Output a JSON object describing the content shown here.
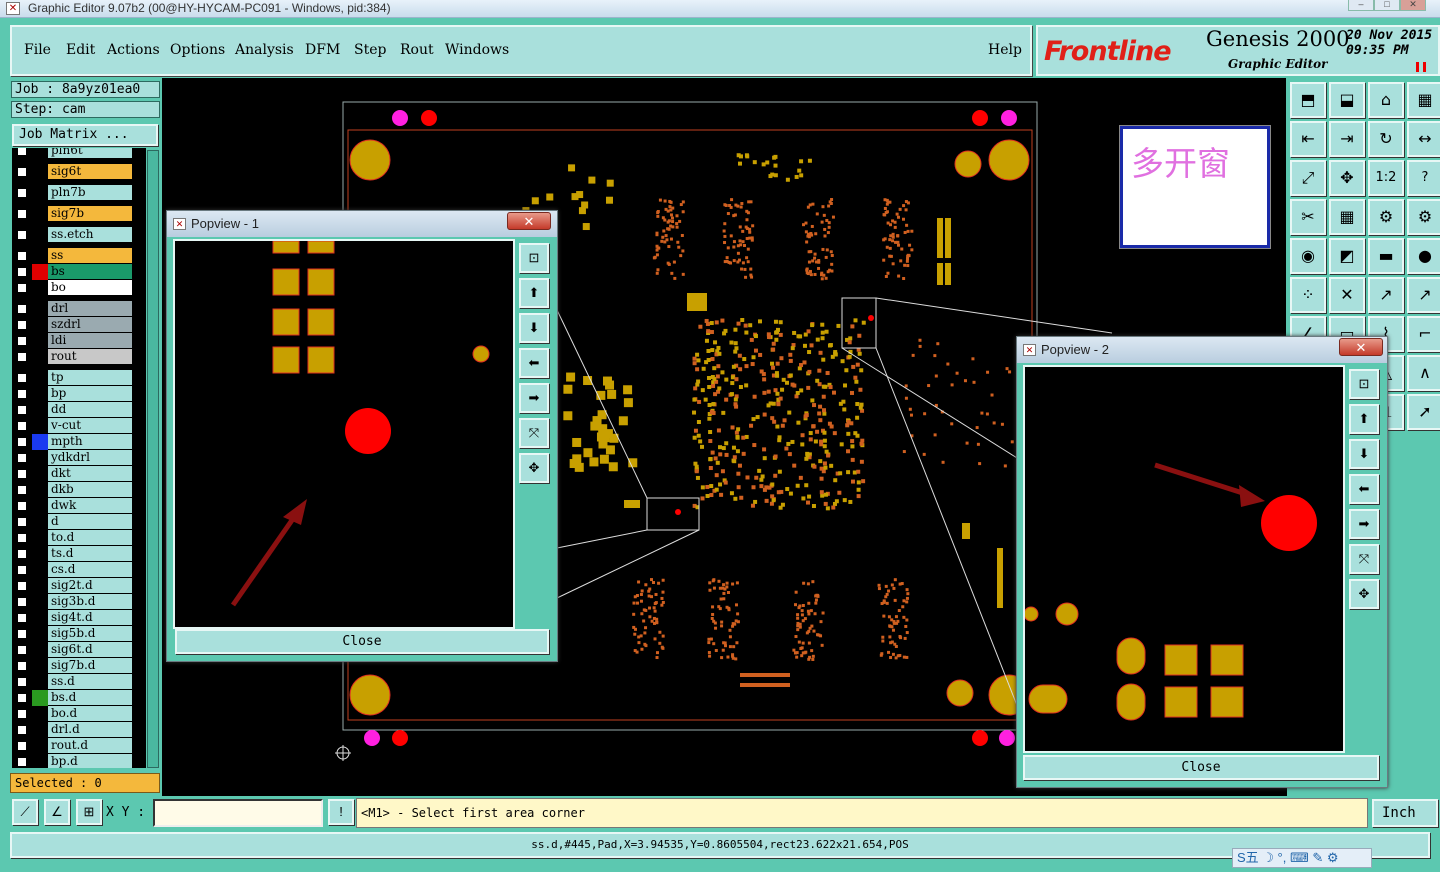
{
  "window": {
    "title": "Graphic Editor 9.07b2 (00@HY-HYCAM-PC091 - Windows, pid:384)"
  },
  "menu": {
    "file": "File",
    "edit": "Edit",
    "actions": "Actions",
    "options": "Options",
    "analysis": "Analysis",
    "dfm": "DFM",
    "step": "Step",
    "rout": "Rout",
    "windows": "Windows",
    "help": "Help"
  },
  "logo": {
    "brand": "Frontline",
    "product": "Genesis 2000",
    "subtitle": "Graphic Editor",
    "date": "20 Nov 2015",
    "time": "09:35 PM"
  },
  "job": {
    "job_label": "Job : 8a9yz01ea0",
    "step_label": "Step: cam",
    "matrix_button": "Job Matrix ..."
  },
  "layers": [
    {
      "name": "pln6t",
      "color": "#a9e0dc",
      "swatch": ""
    },
    {
      "name": "sig6t",
      "color": "#f4b83c",
      "swatch": ""
    },
    {
      "name": "pln7b",
      "color": "#a9e0dc",
      "swatch": ""
    },
    {
      "name": "sig7b",
      "color": "#f4b83c",
      "swatch": ""
    },
    {
      "name": "ss.etch",
      "color": "#a9e0dc",
      "swatch": ""
    },
    {
      "name": "ss",
      "color": "#f4b83c",
      "swatch": ""
    },
    {
      "name": "bs",
      "color": "#1a9a6a",
      "swatch": "#e00000"
    },
    {
      "name": "bo",
      "color": "#ffffff",
      "swatch": ""
    },
    {
      "name": "drl",
      "color": "#9aaab0",
      "swatch": ""
    },
    {
      "name": "szdrl",
      "color": "#9aaab0",
      "swatch": ""
    },
    {
      "name": "ldi",
      "color": "#9aaab0",
      "swatch": ""
    },
    {
      "name": "rout",
      "color": "#c8c8c8",
      "swatch": ""
    },
    {
      "name": "tp",
      "color": "#a9e0dc",
      "swatch": ""
    },
    {
      "name": "bp",
      "color": "#a9e0dc",
      "swatch": ""
    },
    {
      "name": "dd",
      "color": "#a9e0dc",
      "swatch": ""
    },
    {
      "name": "v-cut",
      "color": "#a9e0dc",
      "swatch": ""
    },
    {
      "name": "mpth",
      "color": "#a9e0dc",
      "swatch": "#1a3af0"
    },
    {
      "name": "ydkdrl",
      "color": "#a9e0dc",
      "swatch": ""
    },
    {
      "name": "dkt",
      "color": "#a9e0dc",
      "swatch": ""
    },
    {
      "name": "dkb",
      "color": "#a9e0dc",
      "swatch": ""
    },
    {
      "name": "dwk",
      "color": "#a9e0dc",
      "swatch": ""
    },
    {
      "name": "d",
      "color": "#a9e0dc",
      "swatch": ""
    },
    {
      "name": "to.d",
      "color": "#a9e0dc",
      "swatch": ""
    },
    {
      "name": "ts.d",
      "color": "#a9e0dc",
      "swatch": ""
    },
    {
      "name": "cs.d",
      "color": "#a9e0dc",
      "swatch": ""
    },
    {
      "name": "sig2t.d",
      "color": "#a9e0dc",
      "swatch": ""
    },
    {
      "name": "sig3b.d",
      "color": "#a9e0dc",
      "swatch": ""
    },
    {
      "name": "sig4t.d",
      "color": "#a9e0dc",
      "swatch": ""
    },
    {
      "name": "sig5b.d",
      "color": "#a9e0dc",
      "swatch": ""
    },
    {
      "name": "sig6t.d",
      "color": "#a9e0dc",
      "swatch": ""
    },
    {
      "name": "sig7b.d",
      "color": "#a9e0dc",
      "swatch": ""
    },
    {
      "name": "ss.d",
      "color": "#a9e0dc",
      "swatch": ""
    },
    {
      "name": "bs.d",
      "color": "#a9e0dc",
      "swatch": "#2a9a20"
    },
    {
      "name": "bo.d",
      "color": "#a9e0dc",
      "swatch": ""
    },
    {
      "name": "drl.d",
      "color": "#a9e0dc",
      "swatch": ""
    },
    {
      "name": "rout.d",
      "color": "#a9e0dc",
      "swatch": ""
    },
    {
      "name": "bp.d",
      "color": "#a9e0dc",
      "swatch": ""
    }
  ],
  "selected": "Selected : 0",
  "note": "多开窗",
  "popview1": {
    "title": "Popview - 1",
    "close": "Close"
  },
  "popview2": {
    "title": "Popview - 2",
    "close": "Close"
  },
  "bottom": {
    "xy_label": "X Y :",
    "xy_value": "",
    "message": "<M1> - Select first area corner",
    "unit": "Inch",
    "status": "ss.d,#445,Pad,X=3.94535,Y=0.8605504,rect23.622x21.654,POS"
  },
  "ime": "S五 ☽ °, ⌨ ✎ ⚙",
  "colors": {
    "panel": "#5cc8b0",
    "button": "#a9e0dc",
    "pad": "#c8a000",
    "pad_outline": "#e03020",
    "highlight": "#f4b83c",
    "red": "#ff0000",
    "magenta": "#ff20e0"
  }
}
